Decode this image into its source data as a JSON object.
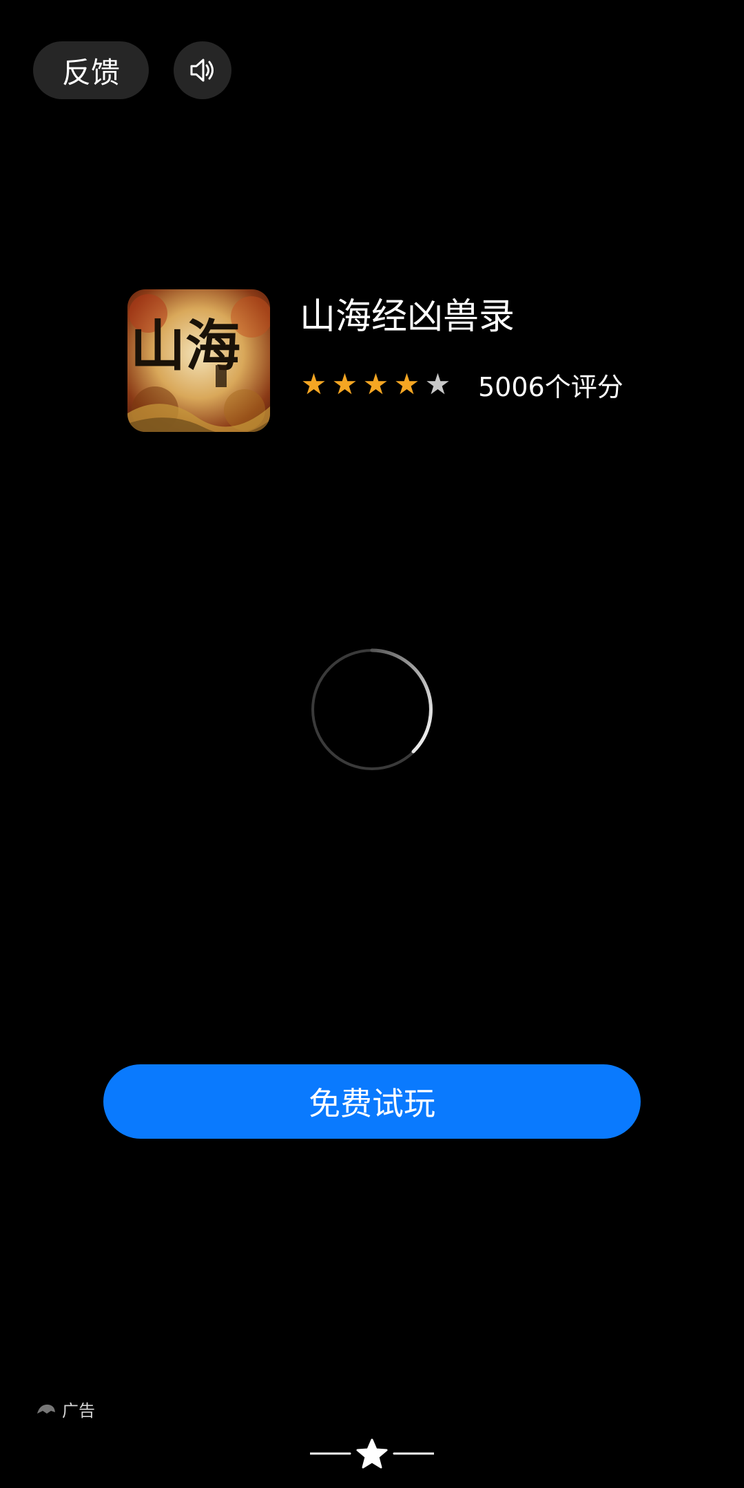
{
  "top_bar": {
    "feedback_label": "反馈",
    "sound_icon": "speaker-icon"
  },
  "app": {
    "icon": "app-logo-icon",
    "icon_glyphs": "山海",
    "title": "山海经凶兽录",
    "rating_stars": 4.5,
    "rating_count_text": "5006个评分",
    "colors": {
      "star_filled": "#f5a623",
      "star_empty": "#c8c8c8"
    }
  },
  "loading": {
    "icon": "loading-spinner-icon"
  },
  "cta": {
    "label": "免费试玩",
    "color": "#0a7afe"
  },
  "ad": {
    "icon": "ad-logo-icon",
    "label": "广告"
  },
  "bottom": {
    "icon": "star-icon"
  }
}
